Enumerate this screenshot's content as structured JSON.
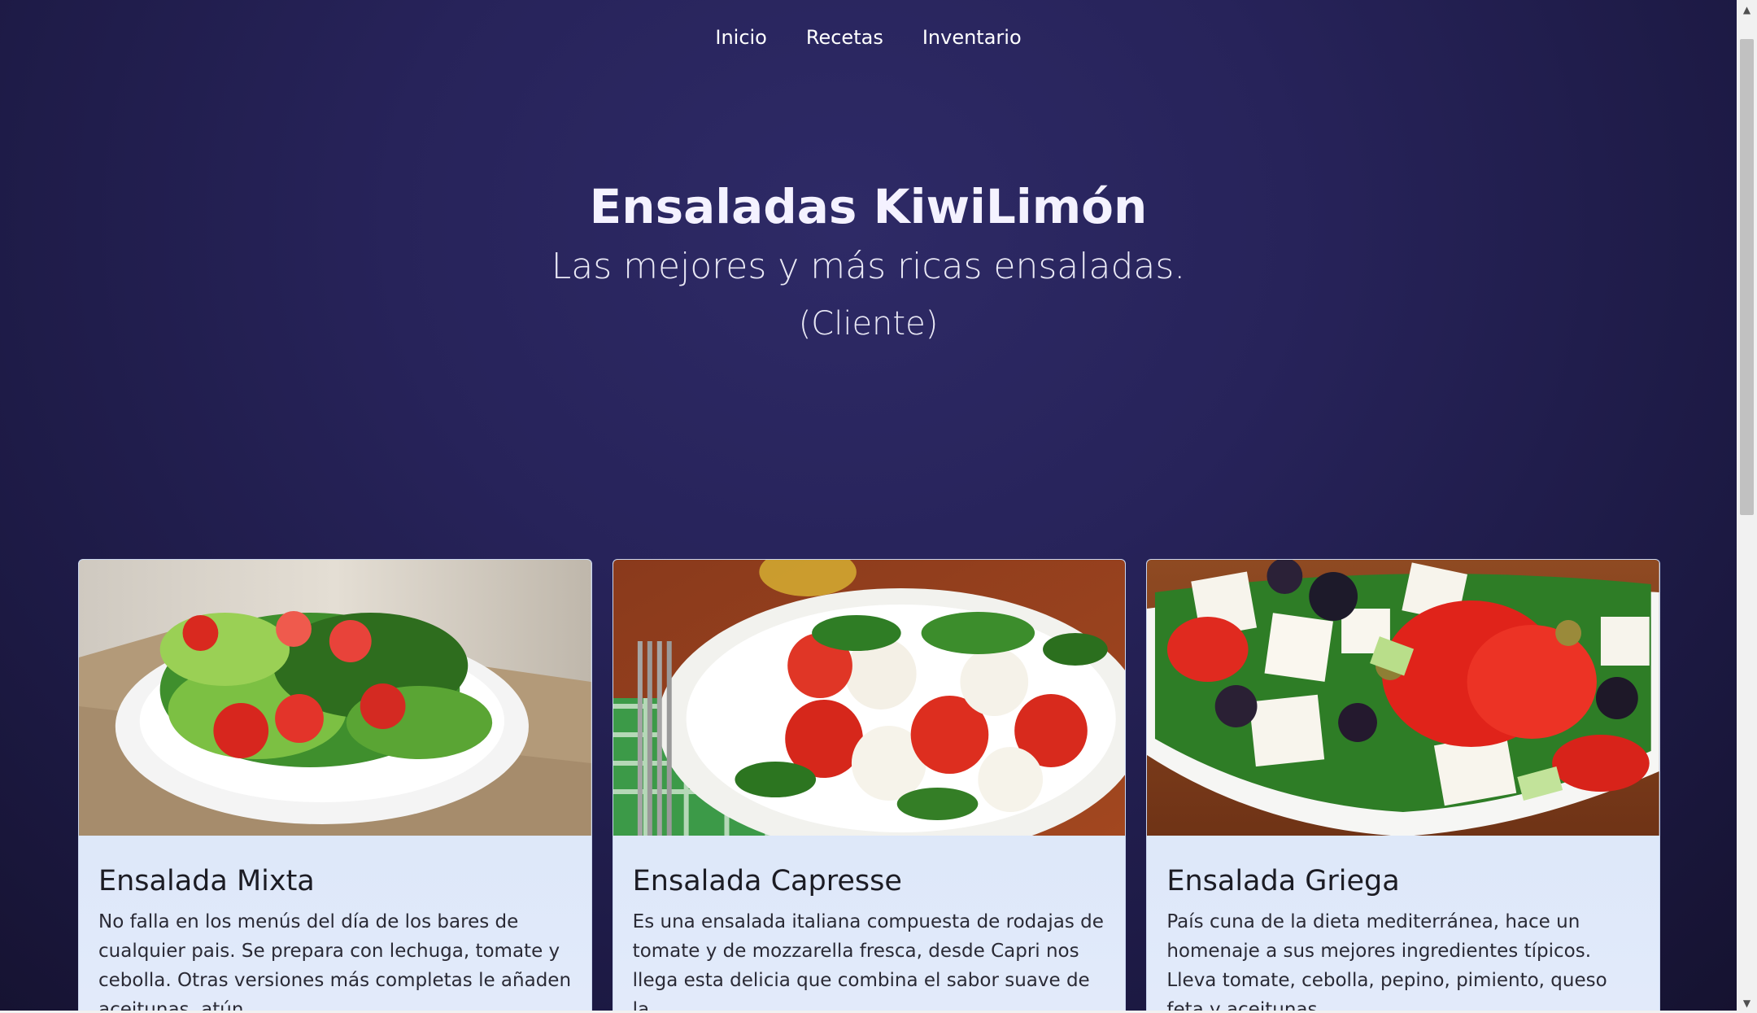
{
  "nav": {
    "items": [
      {
        "label": "Inicio"
      },
      {
        "label": "Recetas"
      },
      {
        "label": "Inventario"
      }
    ]
  },
  "hero": {
    "title": "Ensaladas KiwiLimón",
    "subtitle": "Las mejores y más ricas ensaladas.",
    "role": "(Cliente)"
  },
  "cards": [
    {
      "title": "Ensalada Mixta",
      "text": "No falla en los menús del día de los bares de cualquier pais. Se prepara con lechuga, tomate y cebolla. Otras versiones más completas le añaden aceitunas, atún,",
      "image": "mixed-salad-image"
    },
    {
      "title": "Ensalada Capresse",
      "text": "Es una ensalada italiana compuesta de rodajas de tomate y de mozzarella fresca, desde Capri nos llega esta delicia que combina el sabor suave de la",
      "image": "caprese-salad-image"
    },
    {
      "title": "Ensalada Griega",
      "text": "País cuna de la dieta mediterránea, hace un homenaje a sus mejores ingredientes típicos. Lleva tomate, cebolla, pepino, pimiento, queso feta y aceitunas",
      "image": "greek-salad-image"
    }
  ],
  "colors": {
    "background": "#27235a",
    "card_background": "#dce7f9",
    "text_light": "#ffffff"
  },
  "scrollbar": {
    "up_icon": "arrow-up-icon",
    "down_icon": "arrow-down-icon"
  }
}
